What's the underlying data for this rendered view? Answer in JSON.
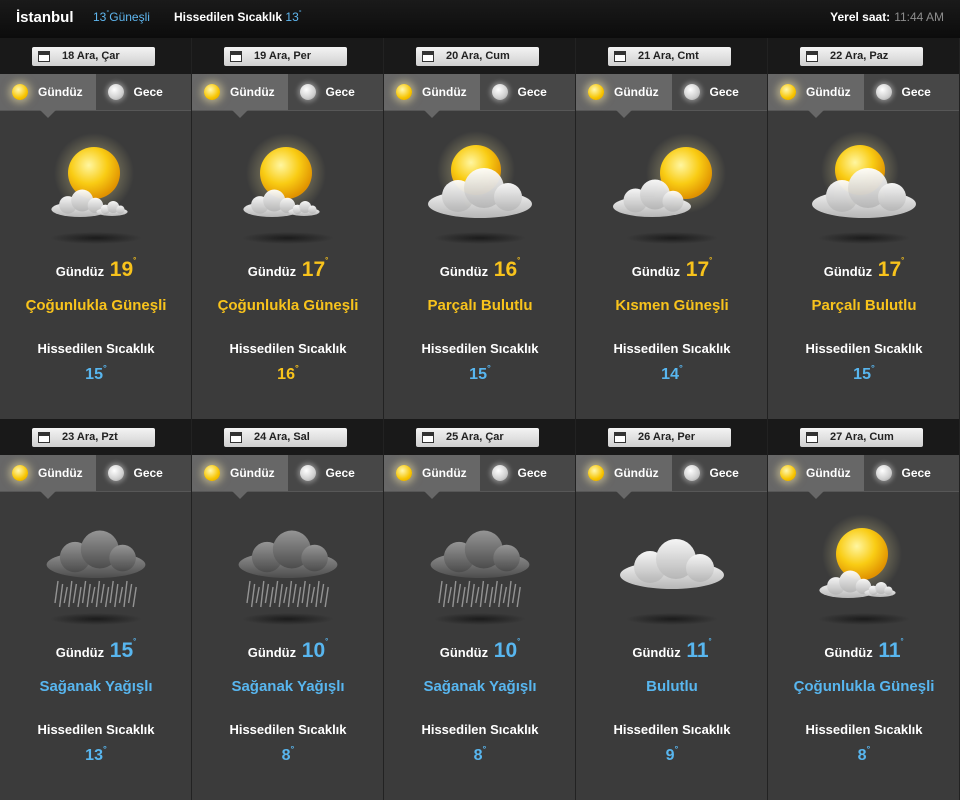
{
  "header": {
    "city": "İstanbul",
    "now_temp": "13",
    "now_condition": "Güneşli",
    "feels_label": "Hissedilen Sıcaklık",
    "feels_value": "13",
    "local_time_label": "Yerel saat:",
    "local_time": "11:44 AM"
  },
  "labels": {
    "day_tab": "Gündüz",
    "night_tab": "Gece",
    "day_prefix": "Gündüz",
    "feels": "Hissedilen Sıcaklık",
    "degree": "°"
  },
  "colors": {
    "warm": "#f8c31c",
    "cool": "#58b6ef"
  },
  "days": [
    {
      "date": "18 Ara, Çar",
      "temp": "19",
      "condition": "Çoğunlukla Güneşli",
      "feels": "15",
      "tone": "warm",
      "feels_tone": "cool",
      "icon": "sun-small-cloud-icon"
    },
    {
      "date": "19 Ara, Per",
      "temp": "17",
      "condition": "Çoğunlukla Güneşli",
      "feels": "16",
      "tone": "warm",
      "feels_tone": "warm",
      "icon": "sun-small-cloud-icon"
    },
    {
      "date": "20 Ara, Cum",
      "temp": "16",
      "condition": "Parçalı Bulutlu",
      "feels": "15",
      "tone": "warm",
      "feels_tone": "cool",
      "icon": "partly-cloudy-icon"
    },
    {
      "date": "21 Ara, Cmt",
      "temp": "17",
      "condition": "Kısmen Güneşli",
      "feels": "14",
      "tone": "warm",
      "feels_tone": "cool",
      "icon": "partly-sunny-icon"
    },
    {
      "date": "22 Ara, Paz",
      "temp": "17",
      "condition": "Parçalı Bulutlu",
      "feels": "15",
      "tone": "warm",
      "feels_tone": "cool",
      "icon": "partly-cloudy-icon"
    },
    {
      "date": "23 Ara, Pzt",
      "temp": "15",
      "condition": "Sağanak Yağışlı",
      "feels": "13",
      "tone": "cool",
      "feels_tone": "cool",
      "icon": "rain-shower-icon"
    },
    {
      "date": "24 Ara, Sal",
      "temp": "10",
      "condition": "Sağanak Yağışlı",
      "feels": "8",
      "tone": "cool",
      "feels_tone": "cool",
      "icon": "rain-shower-icon"
    },
    {
      "date": "25 Ara, Çar",
      "temp": "10",
      "condition": "Sağanak Yağışlı",
      "feels": "8",
      "tone": "cool",
      "feels_tone": "cool",
      "icon": "rain-shower-icon"
    },
    {
      "date": "26 Ara, Per",
      "temp": "11",
      "condition": "Bulutlu",
      "feels": "9",
      "tone": "cool",
      "feels_tone": "cool",
      "icon": "cloudy-icon"
    },
    {
      "date": "27 Ara, Cum",
      "temp": "11",
      "condition": "Çoğunlukla Güneşli",
      "feels": "8",
      "tone": "cool",
      "feels_tone": "cool",
      "icon": "sun-small-cloud-icon"
    }
  ]
}
